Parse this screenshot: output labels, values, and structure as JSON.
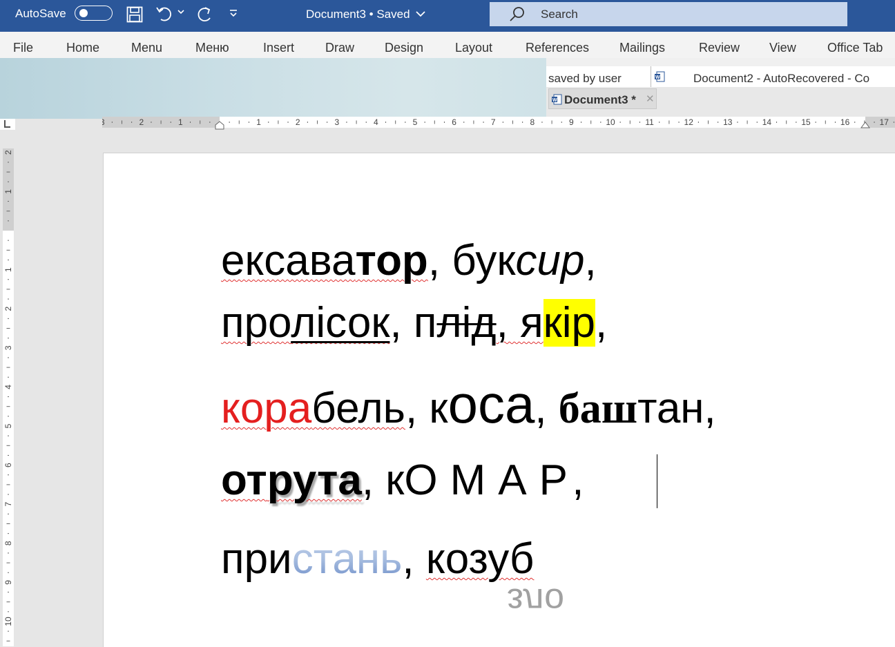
{
  "titlebar": {
    "autosave_label": "AutoSave",
    "autosave_state": "off",
    "doc_title": "Document3 • Saved",
    "search_placeholder": "Search",
    "icons": [
      "save-icon",
      "undo-icon",
      "redo-icon",
      "customize-quick-access-icon",
      "search-icon"
    ]
  },
  "menu": {
    "items": [
      "File",
      "Home",
      "Menu",
      "Меню",
      "Insert",
      "Draw",
      "Design",
      "Layout",
      "References",
      "Mailings",
      "Review",
      "View",
      "Office Tab"
    ]
  },
  "office_tab": {
    "row1_text": "saved by user",
    "doc2_label": "Document2  -  AutoRecovered  -  Co",
    "active_tab": "Document3 *"
  },
  "ruler": {
    "h_labels_left": [
      "3",
      "2",
      "1"
    ],
    "h_labels_right": [
      "1",
      "2",
      "3",
      "4",
      "5",
      "6",
      "7",
      "8",
      "9",
      "10",
      "11",
      "12",
      "13",
      "14",
      "15",
      "16",
      "17"
    ],
    "v_labels": [
      "2",
      "1",
      "1",
      "2",
      "3",
      "4",
      "5",
      "6",
      "7",
      "8",
      "9",
      "10"
    ]
  },
  "document": {
    "line1": {
      "a": "ексава",
      "b": "тор",
      "c": ", бук",
      "d": "сир",
      "e": ","
    },
    "line2": {
      "a": "про",
      "b": "лісок",
      "c": ", п",
      "d": "лід",
      "e": ", я",
      "f": "кір",
      "g": ","
    },
    "line3": {
      "a": "кора",
      "b": "бель",
      "c": ", к",
      "d": "оса",
      "e": ", ",
      "f": "баш",
      "g": "тан",
      "h": ","
    },
    "line4": {
      "a": "от",
      "b": "рута",
      "c": ", к",
      "d": "ОМАР,",
      "e": ""
    },
    "line5": {
      "a": "при",
      "b": "стань",
      "c": ", ",
      "d": "козуб"
    },
    "reflection": "зло"
  }
}
